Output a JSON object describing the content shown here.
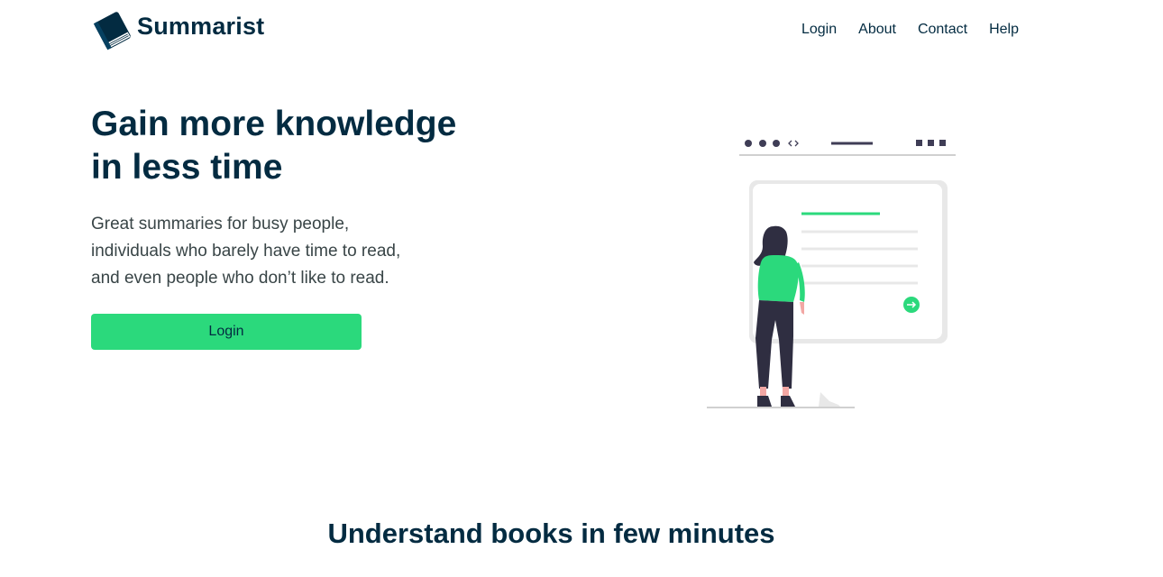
{
  "nav": {
    "brand": "Summarist",
    "links": [
      "Login",
      "About",
      "Contact",
      "Help"
    ]
  },
  "hero": {
    "title_lines": [
      "Gain more knowledge",
      "in less time"
    ],
    "subtitle_lines": [
      "Great summaries for busy people,",
      "individuals who barely have time to read,",
      "and even people who don’t like to read."
    ],
    "button_label": "Login"
  },
  "features": {
    "title": "Understand books in few minutes"
  },
  "colors": {
    "primary_text": "#032b41",
    "accent": "#2bd97c",
    "body_text": "#394547"
  },
  "icons": {
    "logo": "book-icon",
    "illustration": "woman-reading-screen-illustration"
  }
}
